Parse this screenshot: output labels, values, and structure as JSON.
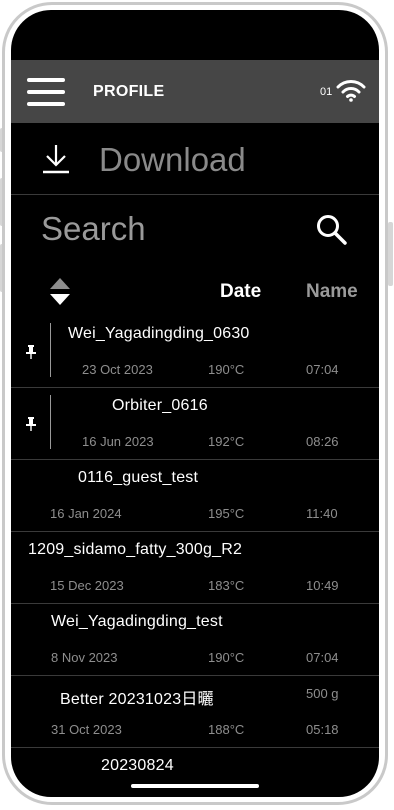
{
  "header": {
    "title": "PROFILE",
    "signal_label": "01"
  },
  "download": {
    "label": "Download"
  },
  "search": {
    "label": "Search"
  },
  "columns": {
    "date": "Date",
    "name": "Name"
  },
  "profiles": [
    {
      "name": "Wei_Yagadingding_0630",
      "date": "23 Oct 2023",
      "temp": "190°C",
      "time": "07:04",
      "pinned": true
    },
    {
      "name": "Orbiter_0616",
      "date": "16 Jun 2023",
      "temp": "192°C",
      "time": "08:26",
      "pinned": true
    },
    {
      "name": "0116_guest_test",
      "date": "16 Jan 2024",
      "temp": "195°C",
      "time": "11:40",
      "pinned": false
    },
    {
      "name": "1209_sidamo_fatty_300g_R2",
      "date": "15 Dec 2023",
      "temp": "183°C",
      "time": "10:49",
      "pinned": false
    },
    {
      "name": "Wei_Yagadingding_test",
      "date": "8 Nov 2023",
      "temp": "190°C",
      "time": "07:04",
      "pinned": false
    },
    {
      "name": "Better 20231023日曬",
      "date": "31 Oct 2023",
      "temp": "188°C",
      "time": "05:18",
      "pinned": false,
      "weight": "500 g"
    },
    {
      "name": "20230824",
      "pinned": false
    }
  ],
  "icons": [
    "hamburger-menu-icon",
    "wifi-icon",
    "download-icon",
    "search-icon",
    "sort-icon",
    "pin-icon"
  ],
  "colors": {
    "background": "#000000",
    "header_bar": "#464646",
    "text_primary": "#ffffff",
    "text_secondary": "#8e8e8e"
  }
}
